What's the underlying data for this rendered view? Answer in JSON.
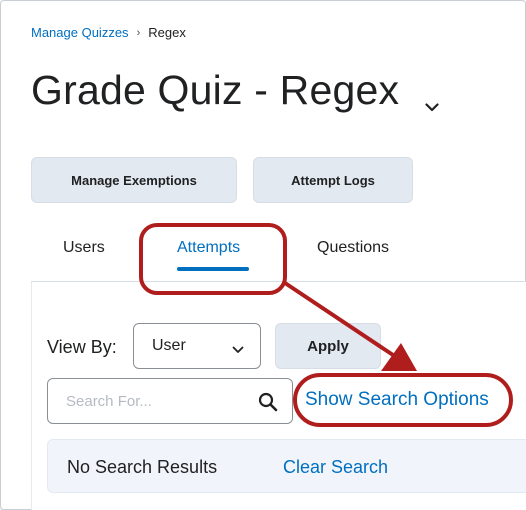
{
  "breadcrumb": {
    "parent": "Manage Quizzes",
    "separator": "›",
    "current": "Regex"
  },
  "page": {
    "title": "Grade Quiz - Regex"
  },
  "toolbar": {
    "manage_exemptions": "Manage Exemptions",
    "attempt_logs": "Attempt Logs"
  },
  "tabs": [
    {
      "label": "Users",
      "selected": false
    },
    {
      "label": "Attempts",
      "selected": true
    },
    {
      "label": "Questions",
      "selected": false
    }
  ],
  "filters": {
    "view_by_label": "View By:",
    "view_by_value": "User",
    "apply_label": "Apply"
  },
  "search": {
    "placeholder": "Search For...",
    "value": "",
    "show_options_label": "Show Search Options"
  },
  "results": {
    "status": "No Search Results",
    "clear_label": "Clear Search"
  },
  "colors": {
    "link": "#006fbf",
    "button_bg": "#e3e9f1",
    "annotation": "#b01d1d"
  },
  "icons": {
    "title_dropdown": "chevron-down-icon",
    "select_dropdown": "chevron-down-icon",
    "search": "search-icon",
    "annotation_arrow": "arrow-icon"
  }
}
